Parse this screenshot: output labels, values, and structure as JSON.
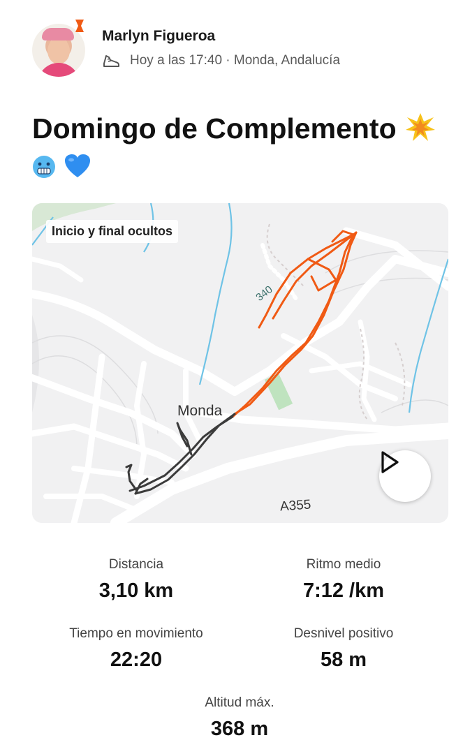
{
  "header": {
    "athlete_name": "Marlyn Figueroa",
    "meta": "Hoy a las 17:40 · Monda, Andalucía",
    "activity_icon": "running-shoe-icon"
  },
  "activity": {
    "title": "Domingo de Complemento",
    "emojis": [
      "collision-emoji",
      "cold-face-emoji",
      "blue-heart-emoji"
    ]
  },
  "map": {
    "privacy_label": "Inicio y final ocultos",
    "town_label": "Monda",
    "road_label": "A355",
    "contour_label": "340",
    "route_colors": {
      "orange": "#f05a14",
      "dark": "#3b3b3b"
    }
  },
  "stats": {
    "distance": {
      "label": "Distancia",
      "value": "3,10 km"
    },
    "pace": {
      "label": "Ritmo medio",
      "value": "7:12 /km"
    },
    "moving_time": {
      "label": "Tiempo en movimiento",
      "value": "22:20"
    },
    "elevation_gain": {
      "label": "Desnivel positivo",
      "value": "58 m"
    },
    "max_altitude": {
      "label": "Altitud máx.",
      "value": "368 m"
    }
  }
}
